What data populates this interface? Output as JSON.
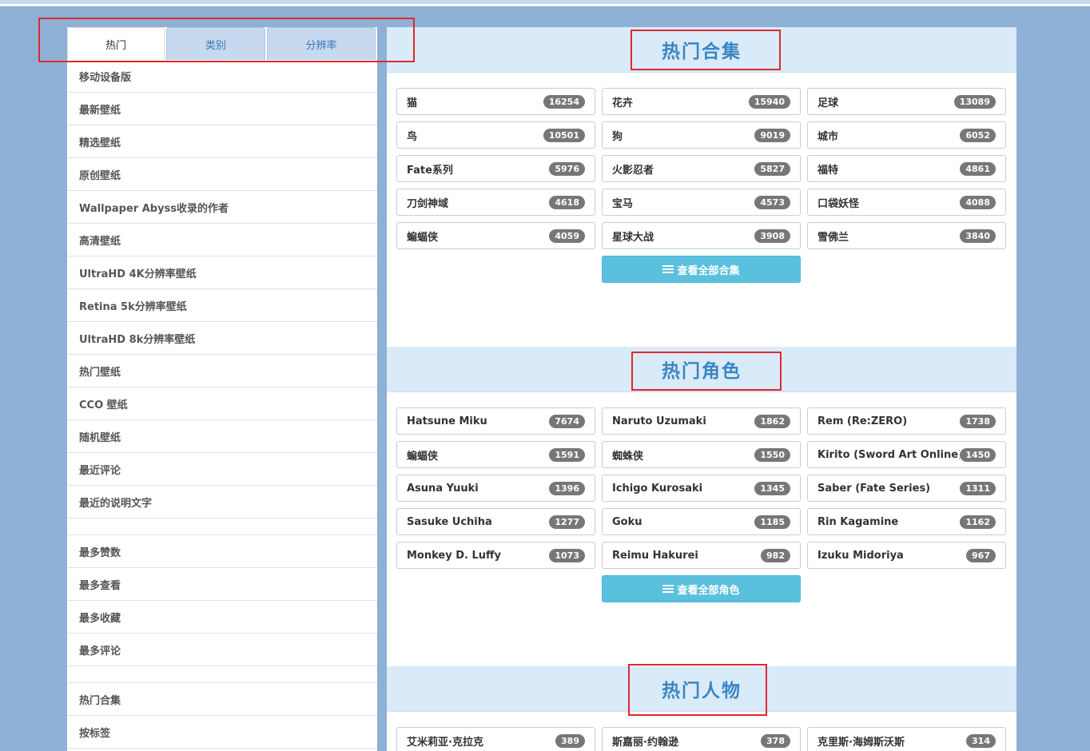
{
  "tabs": [
    {
      "label": "热门"
    },
    {
      "label": "类别"
    },
    {
      "label": "分辨率"
    }
  ],
  "sidebar": {
    "items": [
      "移动设备版",
      "最新壁纸",
      "精选壁纸",
      "原创壁纸",
      "Wallpaper Abyss收录的作者",
      "高清壁纸",
      "UltraHD 4K分辨率壁纸",
      "Retina 5k分辨率壁纸",
      "UltraHD 8k分辨率壁纸",
      "热门壁纸",
      "CCO 壁纸",
      "随机壁纸",
      "最近评论",
      "最近的说明文字",
      "",
      "最多赞数",
      "最多查看",
      "最多收藏",
      "最多评论",
      "",
      "热门合集",
      "按标签"
    ]
  },
  "sections": [
    {
      "title": "热门合集",
      "button": "查看全部合集",
      "items": [
        {
          "label": "猫",
          "count": "16254"
        },
        {
          "label": "花卉",
          "count": "15940"
        },
        {
          "label": "足球",
          "count": "13089"
        },
        {
          "label": "鸟",
          "count": "10501"
        },
        {
          "label": "狗",
          "count": "9019"
        },
        {
          "label": "城市",
          "count": "6052"
        },
        {
          "label": "Fate系列",
          "count": "5976"
        },
        {
          "label": "火影忍者",
          "count": "5827"
        },
        {
          "label": "福特",
          "count": "4861"
        },
        {
          "label": "刀剑神域",
          "count": "4618"
        },
        {
          "label": "宝马",
          "count": "4573"
        },
        {
          "label": "口袋妖怪",
          "count": "4088"
        },
        {
          "label": "蝙蝠侠",
          "count": "4059"
        },
        {
          "label": "星球大战",
          "count": "3908"
        },
        {
          "label": "雪佛兰",
          "count": "3840"
        }
      ]
    },
    {
      "title": "热门角色",
      "button": "查看全部角色",
      "items": [
        {
          "label": "Hatsune Miku",
          "count": "7674"
        },
        {
          "label": "Naruto Uzumaki",
          "count": "1862"
        },
        {
          "label": "Rem (Re:ZERO)",
          "count": "1738"
        },
        {
          "label": "蝙蝠侠",
          "count": "1591"
        },
        {
          "label": "蜘蛛侠",
          "count": "1550"
        },
        {
          "label": "Kirito (Sword Art Online)",
          "count": "1450"
        },
        {
          "label": "Asuna Yuuki",
          "count": "1396"
        },
        {
          "label": "Ichigo Kurosaki",
          "count": "1345"
        },
        {
          "label": "Saber (Fate Series)",
          "count": "1311"
        },
        {
          "label": "Sasuke Uchiha",
          "count": "1277"
        },
        {
          "label": "Goku",
          "count": "1185"
        },
        {
          "label": "Rin Kagamine",
          "count": "1162"
        },
        {
          "label": "Monkey D. Luffy",
          "count": "1073"
        },
        {
          "label": "Reimu Hakurei",
          "count": "982"
        },
        {
          "label": "Izuku Midoriya",
          "count": "967"
        }
      ]
    },
    {
      "title": "热门人物",
      "button": "",
      "items": [
        {
          "label": "艾米莉亚·克拉克",
          "count": "389"
        },
        {
          "label": "斯嘉丽·约翰逊",
          "count": "378"
        },
        {
          "label": "克里斯·海姆斯沃斯",
          "count": "314"
        }
      ]
    }
  ],
  "colors": {
    "accent_red": "#e0282e",
    "heading_blue": "#3b86c4",
    "button_info": "#5bc0de",
    "page_bg": "#8fb1d6"
  },
  "icons": {
    "view_all": "list-icon"
  }
}
